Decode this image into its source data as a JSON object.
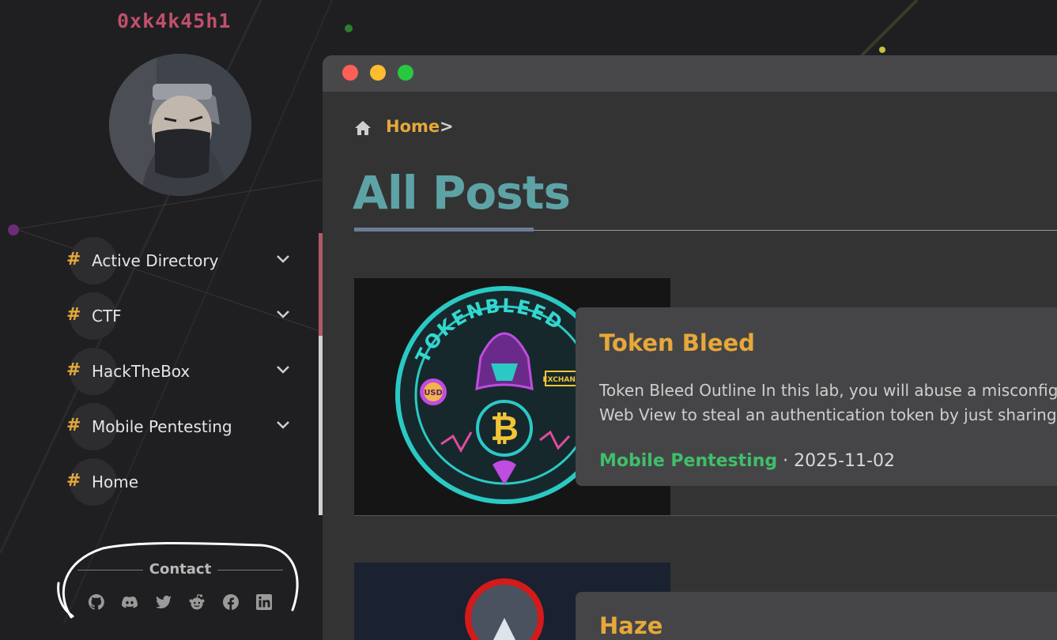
{
  "site": {
    "name": "0xk4k45h1"
  },
  "nav": {
    "items": [
      {
        "label": "Active Directory",
        "expandable": true
      },
      {
        "label": "CTF",
        "expandable": true
      },
      {
        "label": "HackTheBox",
        "expandable": true
      },
      {
        "label": "Mobile Pentesting",
        "expandable": true
      },
      {
        "label": "Home",
        "expandable": false
      }
    ]
  },
  "contact": {
    "title": "Contact",
    "icons": [
      "github-icon",
      "discord-icon",
      "twitter-icon",
      "reddit-icon",
      "facebook-icon",
      "linkedin-icon"
    ]
  },
  "breadcrumb": {
    "home": "Home",
    "separator": ">"
  },
  "page": {
    "title": "All Posts"
  },
  "posts": [
    {
      "title": "Token Bleed",
      "excerpt_lines": [
        "Token Bleed Outline In this lab, you will abuse a misconfig",
        "Web View to steal an authentication token by just sharing"
      ],
      "category": "Mobile Pentesting",
      "date_sep": "·",
      "date": "2025-11-02",
      "image_text": {
        "ring": "TOKENBLEED",
        "usd": "USD",
        "exchange": "EXCHANGE"
      }
    },
    {
      "title": "Haze"
    }
  ],
  "colors": {
    "accent": "#e6a83a",
    "title": "#5da3a6",
    "category": "#3fbf6a",
    "site_name": "#c0506c"
  }
}
